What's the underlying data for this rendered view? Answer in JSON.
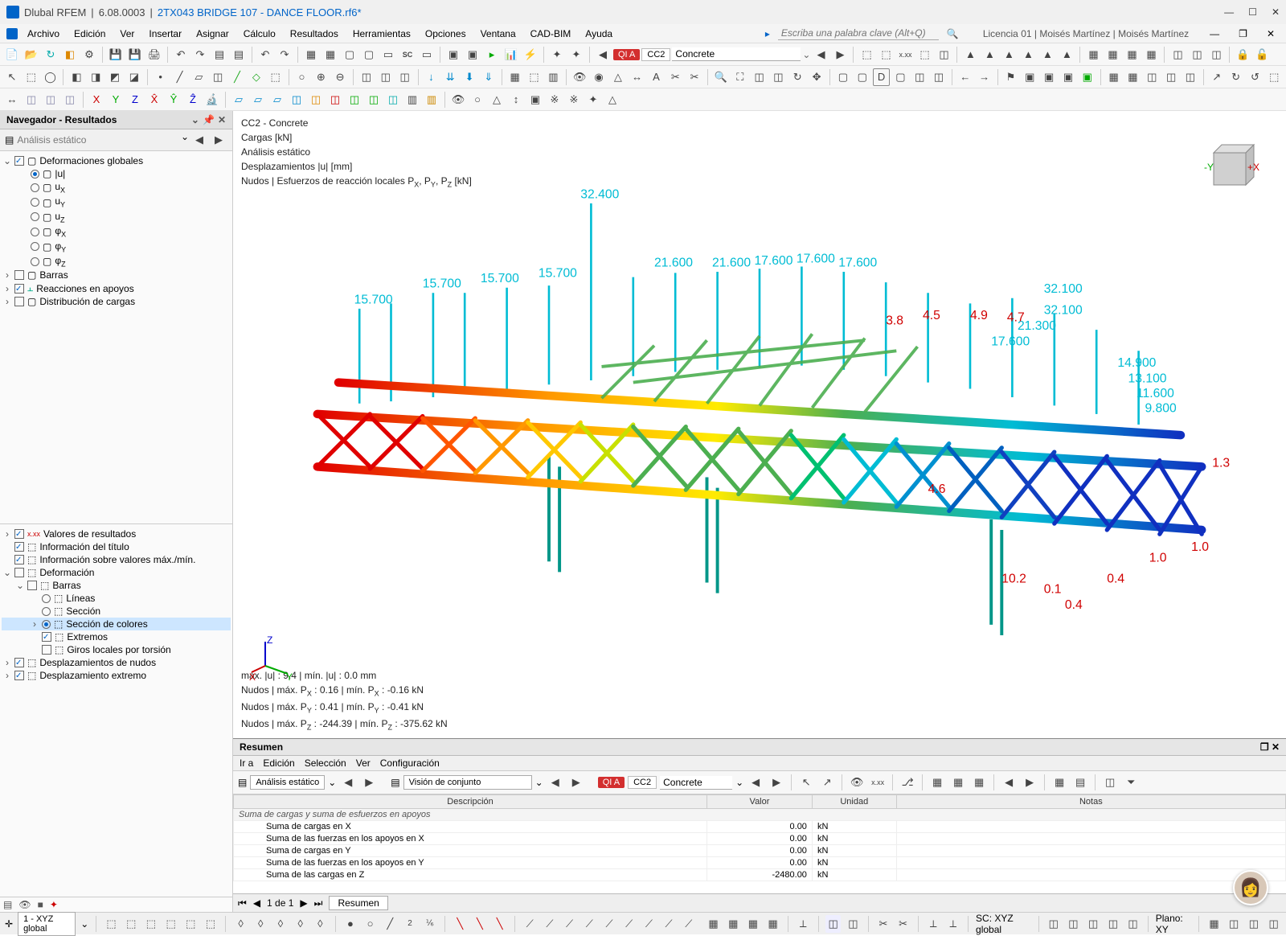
{
  "title": {
    "app": "Dlubal RFEM",
    "version": "6.08.0003",
    "file": "2TX043 BRIDGE 107 - DANCE FLOOR.rf6*"
  },
  "menus": [
    "Archivo",
    "Edición",
    "Ver",
    "Insertar",
    "Asignar",
    "Cálculo",
    "Resultados",
    "Herramientas",
    "Opciones",
    "Ventana",
    "CAD-BIM",
    "Ayuda"
  ],
  "keyword_placeholder": "Escriba una palabra clave (Alt+Q)",
  "license_text": "Licencia 01 | Moisés Martínez | Moisés Martínez",
  "toolbar2": {
    "qi": "QI A",
    "cc": "CC2",
    "concrete": "Concrete"
  },
  "sidebar": {
    "header": "Navegador - Resultados",
    "analysis": "Análisis estático",
    "top_items": [
      {
        "label": "Deformaciones globales",
        "checked": true,
        "expand": true,
        "children": [
          {
            "label": "|u|",
            "radio": true,
            "checked": true
          },
          {
            "label": "uₓ",
            "radio": true
          },
          {
            "label": "uᵧ",
            "radio": true
          },
          {
            "label": "u_Z",
            "radio": true
          },
          {
            "label": "φₓ",
            "radio": true
          },
          {
            "label": "φᵧ",
            "radio": true
          },
          {
            "label": "φ_Z",
            "radio": true
          }
        ]
      },
      {
        "label": "Barras",
        "checked": false
      },
      {
        "label": "Reacciones en apoyos",
        "checked": true
      },
      {
        "label": "Distribución de cargas",
        "checked": false
      }
    ],
    "bottom_items": [
      {
        "label": "Valores de resultados",
        "checked": true
      },
      {
        "label": "Información del título",
        "checked": true
      },
      {
        "label": "Información sobre valores máx./mín.",
        "checked": true
      },
      {
        "label": "Deformación",
        "checked": false,
        "expand": true,
        "children": [
          {
            "label": "Barras",
            "checked": false,
            "expand": true,
            "children": [
              {
                "label": "Líneas",
                "radio": true
              },
              {
                "label": "Sección",
                "radio": true
              },
              {
                "label": "Sección de colores",
                "radio": true,
                "checked": true,
                "selected": true
              },
              {
                "label": "Extremos",
                "checked": true,
                "checkbox": true
              },
              {
                "label": "Giros locales por torsión",
                "checked": false,
                "checkbox": true
              }
            ]
          }
        ]
      },
      {
        "label": "Desplazamientos de nudos",
        "checked": true
      },
      {
        "label": "Desplazamiento extremo",
        "checked": true
      }
    ]
  },
  "vp_info": [
    "CC2 - Concrete",
    "Cargas [kN]",
    "Análisis estático",
    "Desplazamientos |u| [mm]",
    "Nudos | Esfuerzos de reacción locales Pₓ, Pᵧ, P_Z [kN]"
  ],
  "vp_info_bottom": [
    "máx. |u| : 9.4 | mín. |u| : 0.0 mm",
    "Nudos | máx. Pₓ : 0.16 | mín. Pₓ : -0.16 kN",
    "Nudos | máx. Pᵧ : 0.41 | mín. Pᵧ : -0.41 kN",
    "Nudos | máx. P_Z : -244.39 | mín. P_Z : -375.62 kN"
  ],
  "annotations": [
    "32.400",
    "15.700",
    "15.700",
    "15.700",
    "15.700",
    "21.600",
    "21.600",
    "17.600",
    "17.600",
    "17.600",
    "3.8",
    "4.5",
    "4.9",
    "4.7",
    "32.100",
    "32.100",
    "21.300",
    "17.600",
    "14.900",
    "13.100",
    "11.600",
    "9.800",
    "1.3",
    "1.0",
    "1.0",
    "0.1",
    "0.4",
    "0.4",
    "10.2",
    "4.6"
  ],
  "summary": {
    "title": "Resumen",
    "menus": [
      "Ir a",
      "Edición",
      "Selección",
      "Ver",
      "Configuración"
    ],
    "dd1": "Análisis estático",
    "dd2": "Visión de conjunto",
    "qi": "QI A",
    "cc": "CC2",
    "concrete": "Concrete",
    "cols": [
      "Descripción",
      "Valor",
      "Unidad",
      "Notas"
    ],
    "group": "Suma de cargas y suma de esfuerzos en apoyos",
    "rows": [
      {
        "desc": "Suma de cargas en X",
        "val": "0.00",
        "unit": "kN"
      },
      {
        "desc": "Suma de las fuerzas en los apoyos en X",
        "val": "0.00",
        "unit": "kN"
      },
      {
        "desc": "Suma de cargas en Y",
        "val": "0.00",
        "unit": "kN"
      },
      {
        "desc": "Suma de las fuerzas en los apoyos en Y",
        "val": "0.00",
        "unit": "kN"
      },
      {
        "desc": "Suma de las cargas en Z",
        "val": "-2480.00",
        "unit": "kN"
      }
    ],
    "footer": {
      "page": "1 de 1",
      "tab": "Resumen"
    }
  },
  "status": {
    "view": "1 - XYZ global",
    "sc": "SC: XYZ global",
    "plano": "Plano: XY"
  }
}
